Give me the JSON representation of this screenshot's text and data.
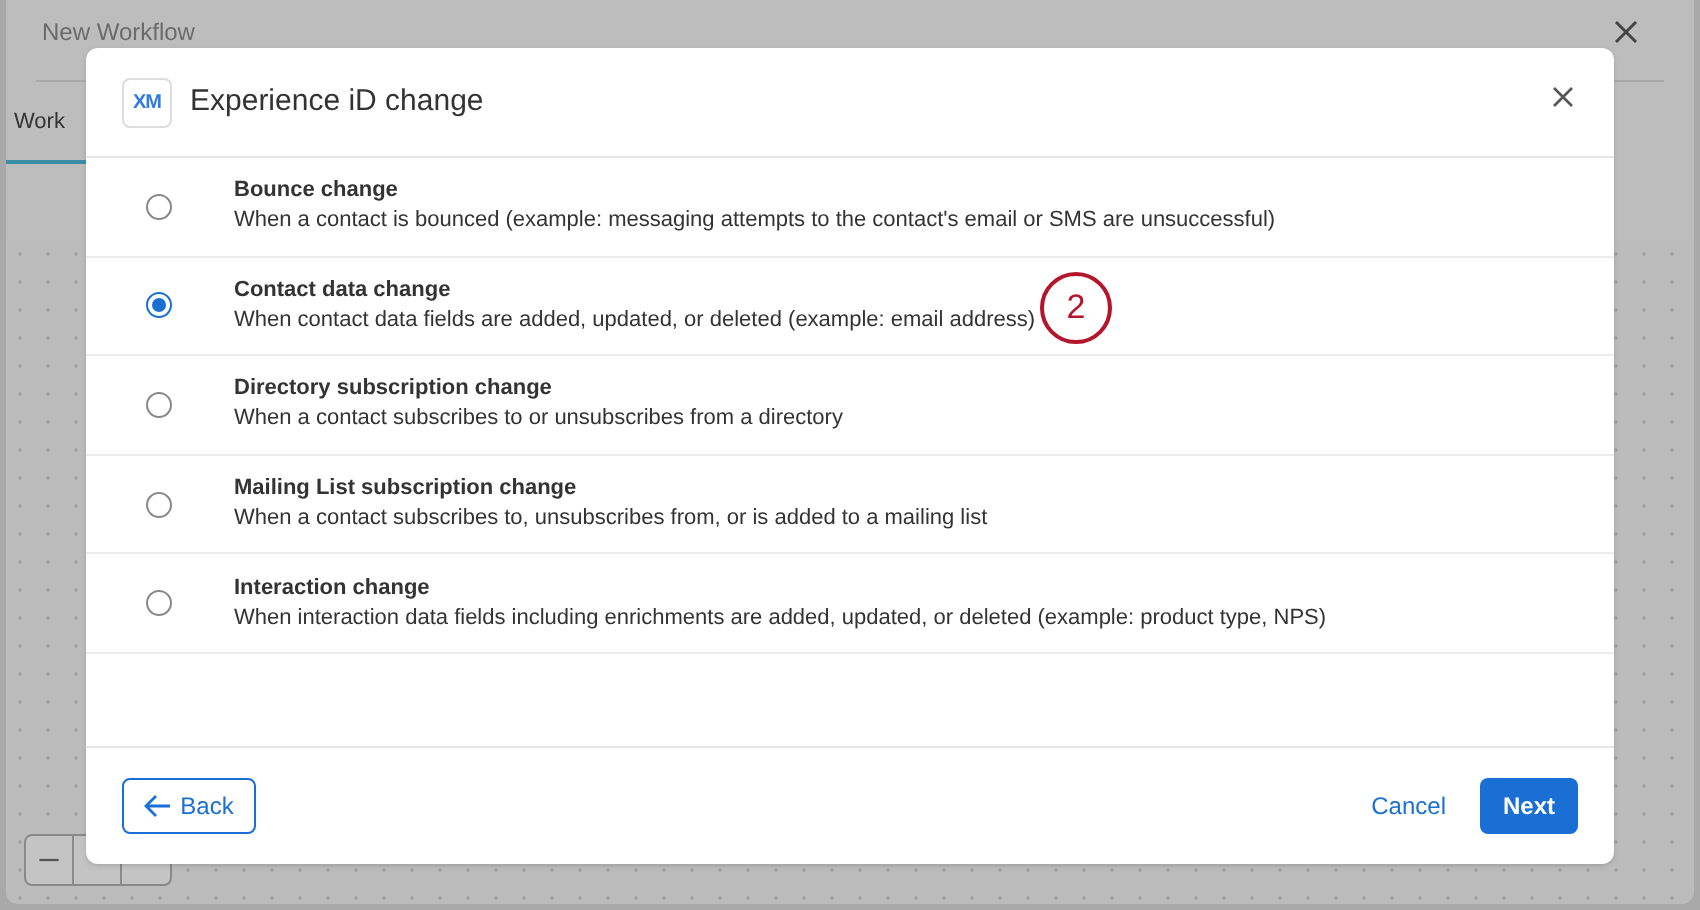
{
  "background": {
    "title": "New Workflow",
    "tab": "Work"
  },
  "dialog": {
    "logo": "XM",
    "title": "Experience iD change",
    "options": [
      {
        "title": "Bounce change",
        "description": "When a contact is bounced (example: messaging attempts to the contact's email or SMS are unsuccessful)",
        "selected": false
      },
      {
        "title": "Contact data change",
        "description": "When contact data fields are added, updated, or deleted (example: email address)",
        "selected": true
      },
      {
        "title": "Directory subscription change",
        "description": "When a contact subscribes to or unsubscribes from a directory",
        "selected": false
      },
      {
        "title": "Mailing List subscription change",
        "description": "When a contact subscribes to, unsubscribes from, or is added to a mailing list",
        "selected": false
      },
      {
        "title": "Interaction change",
        "description": "When interaction data fields including enrichments are added, updated, or deleted (example: product type, NPS)",
        "selected": false
      }
    ],
    "callout": "2",
    "back": "Back",
    "cancel": "Cancel",
    "next": "Next"
  }
}
